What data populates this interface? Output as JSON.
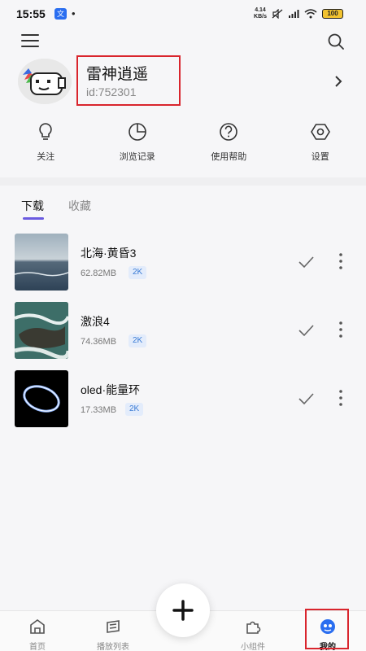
{
  "status_bar": {
    "time": "15:55",
    "app_badge": "文",
    "net_speed_value": "4.14",
    "net_speed_unit": "KB/s",
    "battery": "100"
  },
  "header": {
    "menu_icon": "menu-icon",
    "search_icon": "search-icon"
  },
  "profile": {
    "username": "雷神逍遥",
    "user_id": "id:752301"
  },
  "actions": [
    {
      "label": "关注",
      "icon": "bulb-icon"
    },
    {
      "label": "浏览记录",
      "icon": "pie-icon"
    },
    {
      "label": "使用帮助",
      "icon": "help-icon"
    },
    {
      "label": "设置",
      "icon": "settings-icon"
    }
  ],
  "tabs": {
    "download": "下载",
    "collect": "收藏"
  },
  "downloads": [
    {
      "title": "北海·黄昏3",
      "size": "62.82MB",
      "quality": "2K"
    },
    {
      "title": "激浪4",
      "size": "74.36MB",
      "quality": "2K"
    },
    {
      "title": "oled·能量环",
      "size": "17.33MB",
      "quality": "2K"
    }
  ],
  "bottom_nav": {
    "home": "首页",
    "playlist": "播放列表",
    "widget": "小组件",
    "mine": "我的"
  },
  "colors": {
    "accent": "#6a5ae0",
    "highlight_box": "#d9252d",
    "badge_bg": "#e3ecfb",
    "badge_text": "#3a7bd5"
  }
}
